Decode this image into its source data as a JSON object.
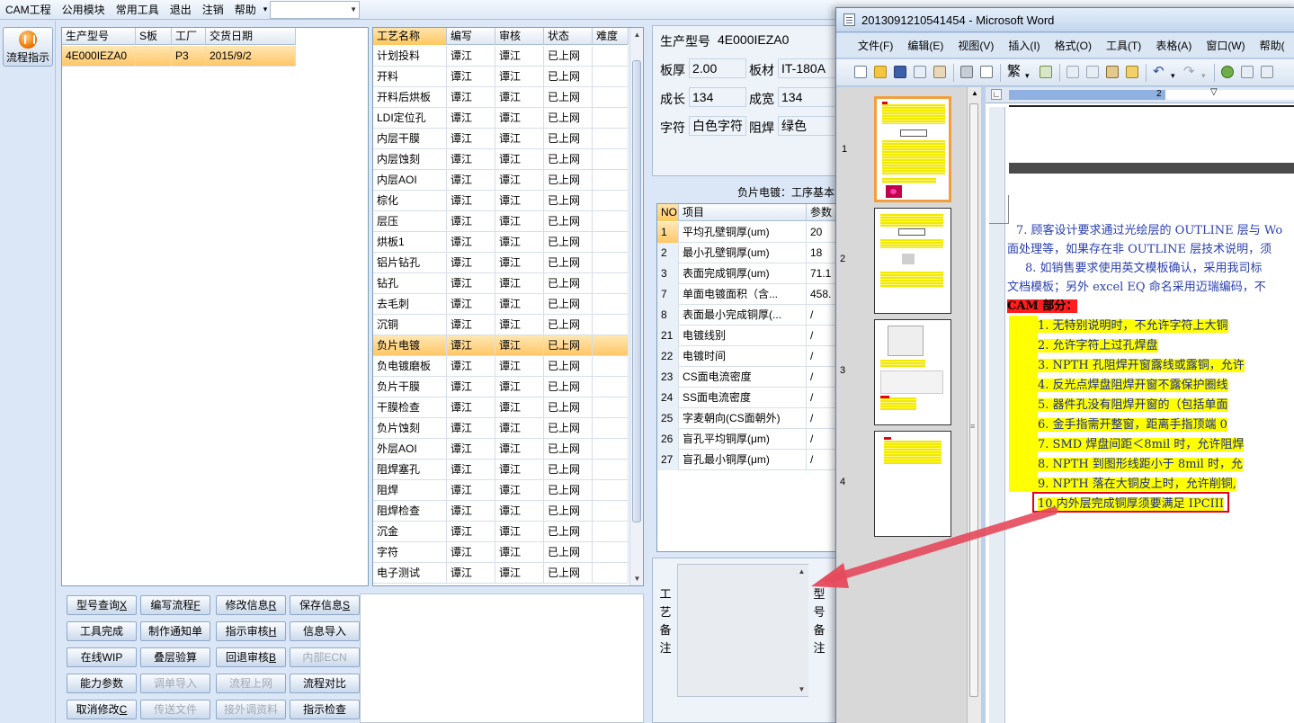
{
  "menubar": {
    "items": [
      "CAM工程",
      "公用模块",
      "常用工具",
      "退出",
      "注销",
      "帮助"
    ],
    "arrow": "▾"
  },
  "left_tool": {
    "flow_button": "流程指示",
    "flow_icon": "pause-icon"
  },
  "models_grid": {
    "headers": [
      "生产型号",
      "S板",
      "工厂",
      "交货日期"
    ],
    "rows": [
      [
        "4E000IEZA0",
        "",
        "P3",
        "2015/9/2"
      ]
    ]
  },
  "process_grid": {
    "headers": [
      "工艺名称",
      "编写",
      "审核",
      "状态",
      "难度"
    ],
    "rows": [
      [
        "计划投料",
        "谭江",
        "谭江",
        "已上网",
        ""
      ],
      [
        "开料",
        "谭江",
        "谭江",
        "已上网",
        ""
      ],
      [
        "开料后烘板",
        "谭江",
        "谭江",
        "已上网",
        ""
      ],
      [
        "LDI定位孔",
        "谭江",
        "谭江",
        "已上网",
        ""
      ],
      [
        "内层干膜",
        "谭江",
        "谭江",
        "已上网",
        ""
      ],
      [
        "内层蚀刻",
        "谭江",
        "谭江",
        "已上网",
        ""
      ],
      [
        "内层AOI",
        "谭江",
        "谭江",
        "已上网",
        ""
      ],
      [
        "棕化",
        "谭江",
        "谭江",
        "已上网",
        ""
      ],
      [
        "层压",
        "谭江",
        "谭江",
        "已上网",
        ""
      ],
      [
        "烘板1",
        "谭江",
        "谭江",
        "已上网",
        ""
      ],
      [
        "铝片钻孔",
        "谭江",
        "谭江",
        "已上网",
        ""
      ],
      [
        "钻孔",
        "谭江",
        "谭江",
        "已上网",
        ""
      ],
      [
        "去毛刺",
        "谭江",
        "谭江",
        "已上网",
        ""
      ],
      [
        "沉铜",
        "谭江",
        "谭江",
        "已上网",
        ""
      ],
      [
        "负片电镀",
        "谭江",
        "谭江",
        "已上网",
        ""
      ],
      [
        "负电镀磨板",
        "谭江",
        "谭江",
        "已上网",
        ""
      ],
      [
        "负片干膜",
        "谭江",
        "谭江",
        "已上网",
        ""
      ],
      [
        "干膜检查",
        "谭江",
        "谭江",
        "已上网",
        ""
      ],
      [
        "负片蚀刻",
        "谭江",
        "谭江",
        "已上网",
        ""
      ],
      [
        "外层AOI",
        "谭江",
        "谭江",
        "已上网",
        ""
      ],
      [
        "阻焊塞孔",
        "谭江",
        "谭江",
        "已上网",
        ""
      ],
      [
        "阻焊",
        "谭江",
        "谭江",
        "已上网",
        ""
      ],
      [
        "阻焊检查",
        "谭江",
        "谭江",
        "已上网",
        ""
      ],
      [
        "沉金",
        "谭江",
        "谭江",
        "已上网",
        ""
      ],
      [
        "字符",
        "谭江",
        "谭江",
        "已上网",
        ""
      ],
      [
        "电子测试",
        "谭江",
        "谭江",
        "已上网",
        ""
      ]
    ],
    "selected_index": 14
  },
  "info": {
    "model_label": "生产型号",
    "model_value": "4E000IEZA0",
    "thickness_label": "板厚",
    "thickness_value": "2.00",
    "material_label": "板材",
    "material_value": "IT-180A",
    "length_label": "成长",
    "length_value": "134",
    "width_label": "成宽",
    "width_value": "134",
    "char_label": "字符",
    "char_value": "白色字符",
    "mask_label": "阻焊",
    "mask_value": "绿色"
  },
  "params": {
    "title": "负片电镀：工序基本",
    "headers": [
      "NO",
      "项目",
      "参数"
    ],
    "rows": [
      [
        "1",
        "平均孔壁铜厚(um)",
        "20"
      ],
      [
        "2",
        "最小孔壁铜厚(um)",
        "18"
      ],
      [
        "3",
        "表面完成铜厚(um)",
        "71.1"
      ],
      [
        "7",
        "单面电镀面积（含...",
        "458."
      ],
      [
        "8",
        "表面最小完成铜厚(...",
        "/"
      ],
      [
        "21",
        "电镀线别",
        "/"
      ],
      [
        "22",
        "电镀时间",
        "/"
      ],
      [
        "23",
        "CS面电流密度",
        "/"
      ],
      [
        "24",
        "SS面电流密度",
        "/"
      ],
      [
        "25",
        "字麦朝向(CS面朝外)",
        "/"
      ],
      [
        "26",
        "盲孔平均铜厚(μm)",
        "/"
      ],
      [
        "27",
        "盲孔最小铜厚(μm)",
        "/"
      ]
    ]
  },
  "notes": {
    "process_note_label": [
      "工",
      "艺",
      "备",
      "注"
    ],
    "model_note_label": [
      "型",
      "号",
      "备",
      "注"
    ]
  },
  "buttons": [
    [
      "型号查询",
      "X",
      true
    ],
    [
      "编写流程",
      "F",
      true
    ],
    [
      "修改信息",
      "R",
      true
    ],
    [
      "保存信息",
      "S",
      true
    ],
    [
      "工具完成",
      "",
      true
    ],
    [
      "制作通知单",
      "",
      true
    ],
    [
      "指示审核",
      "H",
      true
    ],
    [
      "信息导入",
      "",
      true
    ],
    [
      "在线WIP",
      "",
      true
    ],
    [
      "叠层验算",
      "",
      true
    ],
    [
      "回退审核",
      "B",
      true
    ],
    [
      "内部ECN",
      "",
      false
    ],
    [
      "能力参数",
      "",
      true
    ],
    [
      "调单导入",
      "",
      false
    ],
    [
      "流程上网",
      "",
      false
    ],
    [
      "流程对比",
      "",
      true
    ],
    [
      "取消修改",
      "C",
      true
    ],
    [
      "传送文件",
      "",
      false
    ],
    [
      "接外调资料",
      "",
      false
    ],
    [
      "指示检查",
      "",
      true
    ]
  ],
  "word": {
    "title": "2013091210541454 - Microsoft Word",
    "menu": [
      "文件(F)",
      "编辑(E)",
      "视图(V)",
      "插入(I)",
      "格式(O)",
      "工具(T)",
      "表格(A)",
      "窗口(W)",
      "帮助("
    ],
    "page_numbers": [
      "1",
      "2",
      "3",
      "4"
    ],
    "ruler_number": "2",
    "lines": [
      "7. 顾客设计要求通过光绘层的 OUTLINE 层与 Wo",
      "面处理等，如果存在非 OUTLINE 层技术说明，须",
      "8. 如销售要求使用英文模板确认，采用我司标",
      "文档模板；另外 excel EQ 命名采用迈瑞编码，不",
      "CAM 部分：",
      "1. 无特别说明时，不允许字符上大铜",
      "2. 允许字符上过孔焊盘",
      "3. NPTH 孔阻焊开窗露线或露铜，允许",
      "4. 反光点焊盘阻焊开窗不露保护圈线",
      "5. 器件孔没有阻焊开窗的（包括单面",
      "6. 金手指需开整窗，距离手指顶端 0",
      "7. SMD 焊盘间距＜8mil 时，允许阻焊",
      "8. NPTH 到图形线距小于 8mil 时，允",
      "9. NPTH 落在大铜皮上时，允许削铜,",
      "10.内外层完成铜厚须要满足 IPCIII"
    ]
  },
  "colors": {
    "selection": "#ffc767",
    "highlight": "#ffff00",
    "arrow": "#e64a5c",
    "redbox": "#e3001b"
  }
}
